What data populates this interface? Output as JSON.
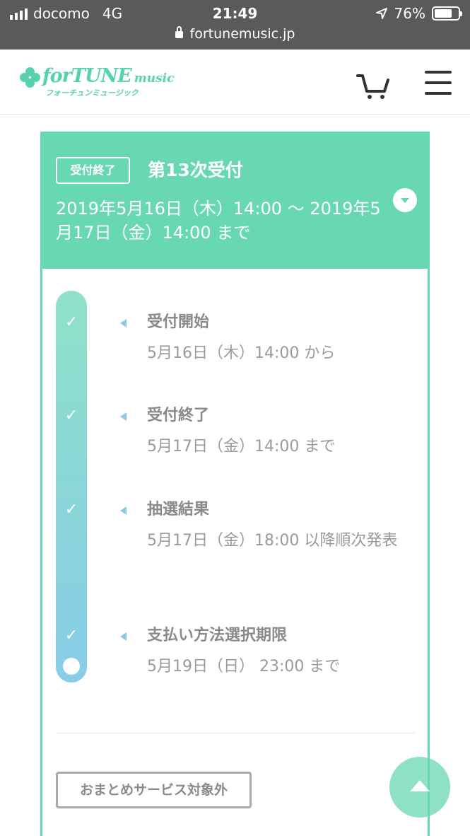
{
  "status_bar": {
    "carrier": "docomo",
    "network": "4G",
    "time": "21:49",
    "battery": "76%",
    "battery_level": 0.76,
    "url": "fortunemusic.jp"
  },
  "header": {
    "logo_text": "forTUNE",
    "logo_suffix": "music",
    "logo_kana": "フォーチュンミュージック",
    "brand_color": "#57d2ae"
  },
  "round": {
    "status": "受付終了",
    "title": "第13次受付",
    "period": "2019年5月16日（木）14:00 〜 2019年5月17日（金）14:00 まで",
    "accent_color": "#68d7b4"
  },
  "timeline": [
    {
      "title": "受付開始",
      "date": "5月16日（木）14:00 から"
    },
    {
      "title": "受付終了",
      "date": "5月17日（金）14:00 まで"
    },
    {
      "title": "抽選結果",
      "date": "5月17日（金）18:00 以降順次発表"
    },
    {
      "title": "支払い方法選択期限",
      "date": "5月19日（日） 23:00 まで"
    }
  ],
  "service_tag": "おまとめサービス対象外",
  "icons": {
    "signal": "signal-icon",
    "location": "location-arrow-icon",
    "battery": "battery-icon",
    "lock": "lock-icon",
    "cart": "cart-icon",
    "menu": "hamburger-menu-icon",
    "toggle": "chevron-down-icon",
    "check": "check-icon",
    "back_to_top": "arrow-up-icon"
  }
}
